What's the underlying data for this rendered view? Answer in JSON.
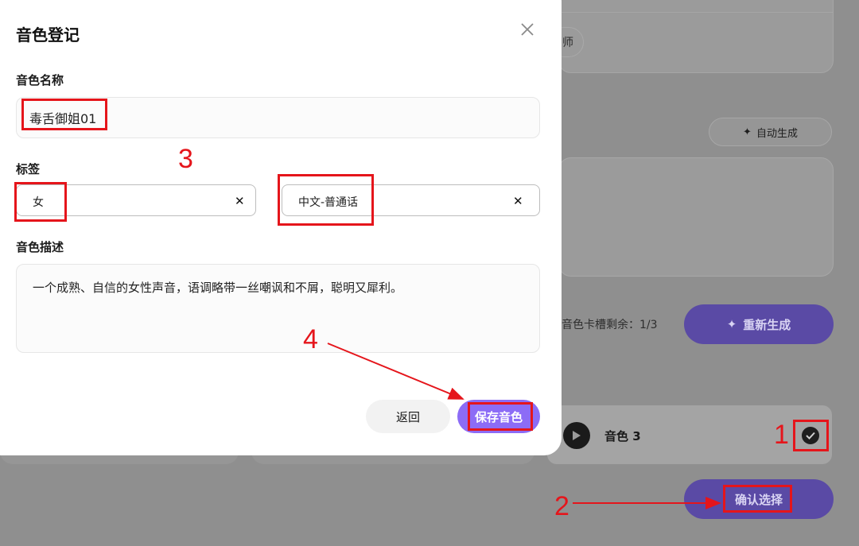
{
  "background": {
    "teacher_chip": "师",
    "autogen_label": "自动生成",
    "slots_text": "音色卡槽剩余：1/3",
    "regen_label": "重新生成",
    "voice_name": "音色 3",
    "confirm_label": "确认选择"
  },
  "modal": {
    "title": "音色登记",
    "name_label": "音色名称",
    "name_value": "毒舌御姐01",
    "tags_label": "标签",
    "tags": [
      "女",
      "中文-普通话"
    ],
    "desc_label": "音色描述",
    "desc_value": "一个成熟、自信的女性声音，语调略带一丝嘲讽和不屑，聪明又犀利。",
    "back_label": "返回",
    "save_label": "保存音色"
  },
  "annotations": {
    "n1": "1",
    "n2": "2",
    "n3": "3",
    "n4": "4",
    "color": "#e5151b"
  },
  "colors": {
    "accent": "#8c6cf6",
    "accent_dimmed": "#5a4aa5"
  }
}
